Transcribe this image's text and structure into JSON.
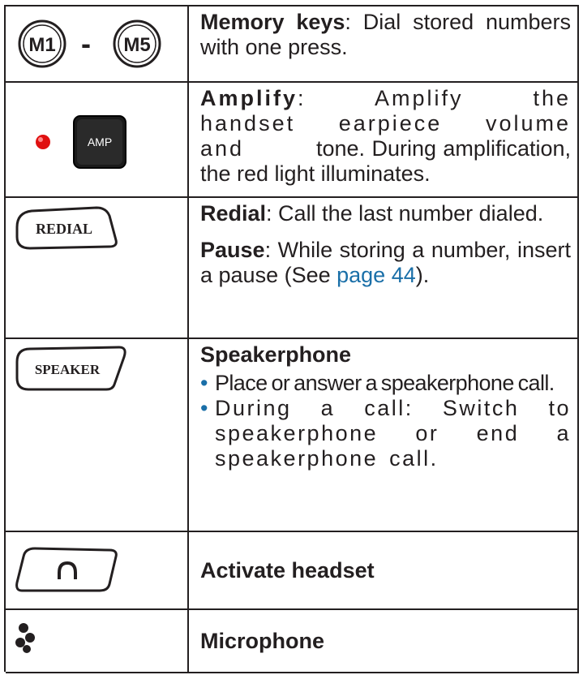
{
  "rows": {
    "memory": {
      "icon_left_label": "M1",
      "dash": "-",
      "icon_right_label": "M5",
      "title": "Memory keys",
      "separator": ":",
      "text": " Dial stored numbers with one press."
    },
    "amplify": {
      "icon_label": "AMP",
      "indicator_color": "#e01010",
      "title": "Amplify",
      "separator": ":",
      "text_wide": " Amplify the handset earpiece volume and",
      "text_rest": " tone. During amplification, the red light illuminates."
    },
    "redial": {
      "icon_label": "REDIAL",
      "title": "Redial",
      "separator": ":",
      "text": " Call the last number dialed.",
      "pause_title": "Pause",
      "pause_text": ": While storing a number, insert a pause (See ",
      "pause_link": "page 44",
      "pause_end": ")."
    },
    "speaker": {
      "icon_label": "SPEAKER",
      "title": "Speakerphone",
      "bullets": [
        "Place or answer a speakerphone call.",
        "During a call: Switch to speakerphone or end a speakerphone call."
      ]
    },
    "headset": {
      "icon_name": "headset-icon",
      "title": "Activate headset"
    },
    "microphone": {
      "icon_name": "microphone-icon",
      "title": "Microphone"
    }
  }
}
